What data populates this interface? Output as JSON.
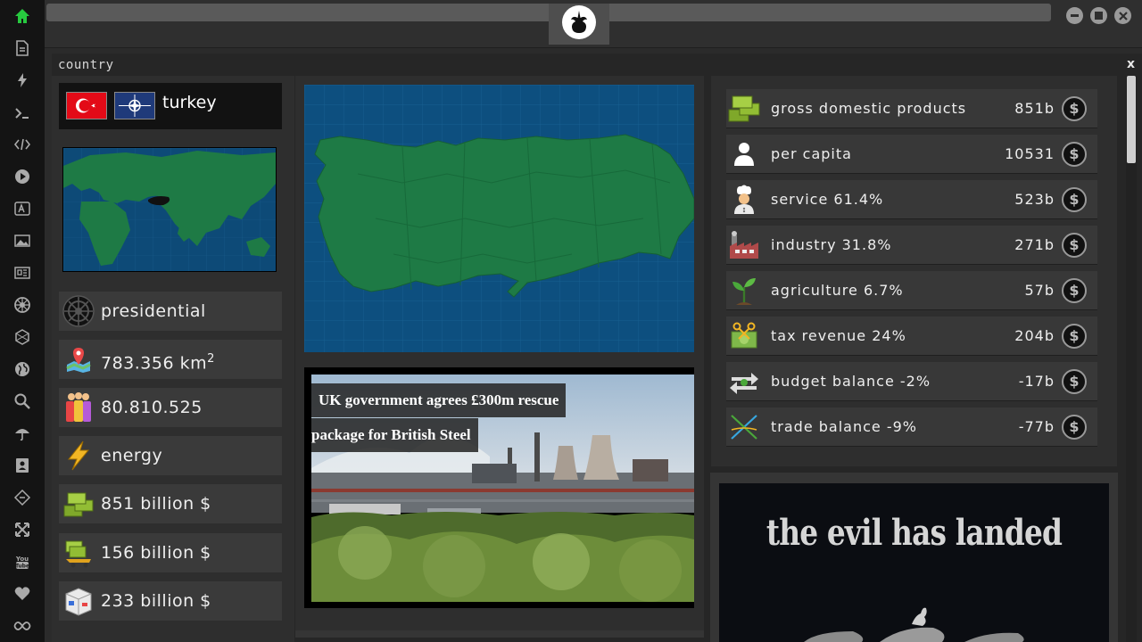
{
  "sidebar": {
    "icons": [
      "home-icon",
      "document-icon",
      "lightning-icon",
      "terminal-icon",
      "code-icon",
      "play-icon",
      "translate-icon",
      "image-icon",
      "news-icon",
      "empire-icon",
      "hexagon-icon",
      "globe-icon",
      "search-icon",
      "umbrella-icon",
      "contacts-icon",
      "diamond-code-icon",
      "expand-icon",
      "youtube-icon",
      "heart-icon",
      "infinity-icon"
    ],
    "home_color": "#27c93f"
  },
  "window": {
    "title": "country",
    "close_label": "x"
  },
  "country": {
    "name": "turkey",
    "government": "presidential",
    "area": "783.356 km",
    "area_sup": "2",
    "population": "80.810.525",
    "energy": "energy",
    "gdp": "851 billion $",
    "stat2": "156 billion $",
    "stat3": "233 billion $"
  },
  "news": {
    "line1": "UK government agrees £300m rescue",
    "line2": "package for British Steel"
  },
  "economy": [
    {
      "label": "gross domestic products",
      "value": "851b",
      "icon": "money-stack-icon"
    },
    {
      "label": "per capita",
      "value": "10531",
      "icon": "person-icon"
    },
    {
      "label": "service 61.4%",
      "value": "523b",
      "icon": "chef-icon"
    },
    {
      "label": "industry 31.8%",
      "value": "271b",
      "icon": "factory-icon"
    },
    {
      "label": "agriculture 6.7%",
      "value": "57b",
      "icon": "plant-icon"
    },
    {
      "label": "tax revenue 24%",
      "value": "204b",
      "icon": "tax-icon"
    },
    {
      "label": "budget balance -2%",
      "value": "-17b",
      "icon": "balance-arrows-icon"
    },
    {
      "label": "trade balance -9%",
      "value": "-77b",
      "icon": "trade-icon"
    }
  ],
  "coin_symbol": "$",
  "promo": {
    "title": "the evil has landed"
  },
  "colors": {
    "map_sea": "#0d4f7f",
    "map_land": "#1e7a45",
    "accent_green": "#27c93f"
  }
}
